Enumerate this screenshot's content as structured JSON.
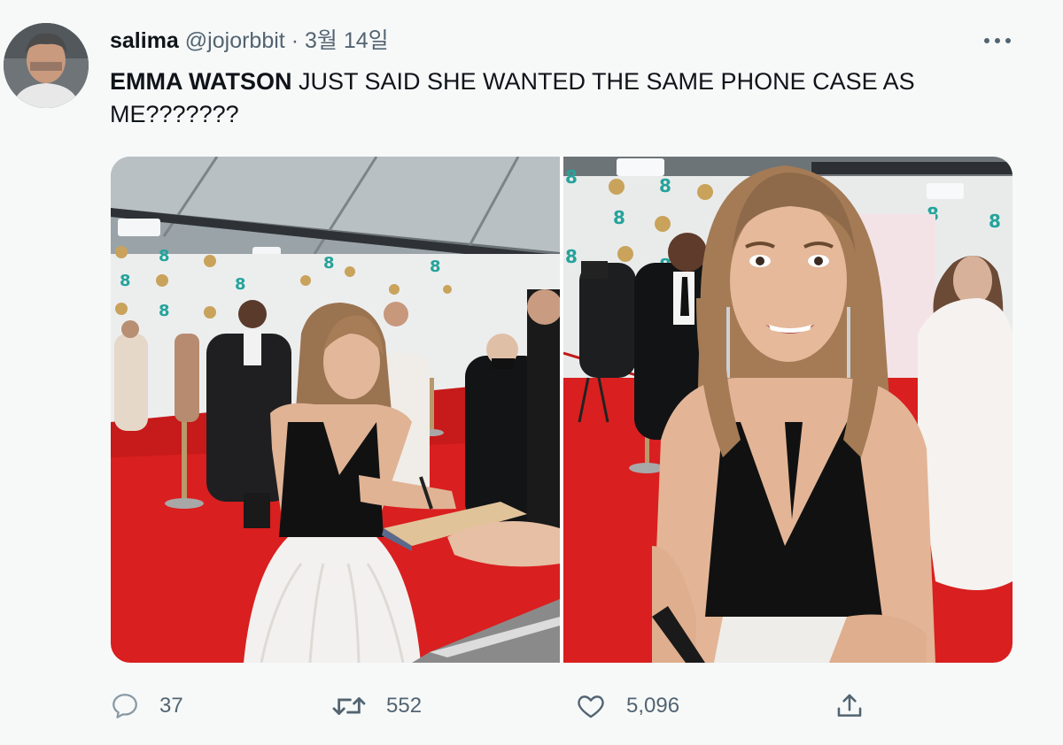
{
  "author": {
    "display_name": "salima",
    "handle": "@jojorbbit",
    "separator": "·",
    "date": "3월 14일"
  },
  "tweet": {
    "text_bold": "EMMA WATSON",
    "text_rest": " JUST SAID SHE WANTED THE SAME PHONE CASE AS ME???????"
  },
  "media": {
    "photos": [
      "photo-1",
      "photo-2"
    ]
  },
  "actions": {
    "reply_count": "37",
    "retweet_count": "552",
    "like_count": "5,096"
  },
  "icons": {
    "more": "more-horizontal-icon",
    "reply": "reply-bubble-icon",
    "retweet": "retweet-arrows-icon",
    "like": "heart-icon",
    "share": "share-upload-icon"
  },
  "colors": {
    "background": "#f7f9f9",
    "text": "#0f1419",
    "secondary": "#536471",
    "carpet": "#d91f1f"
  }
}
